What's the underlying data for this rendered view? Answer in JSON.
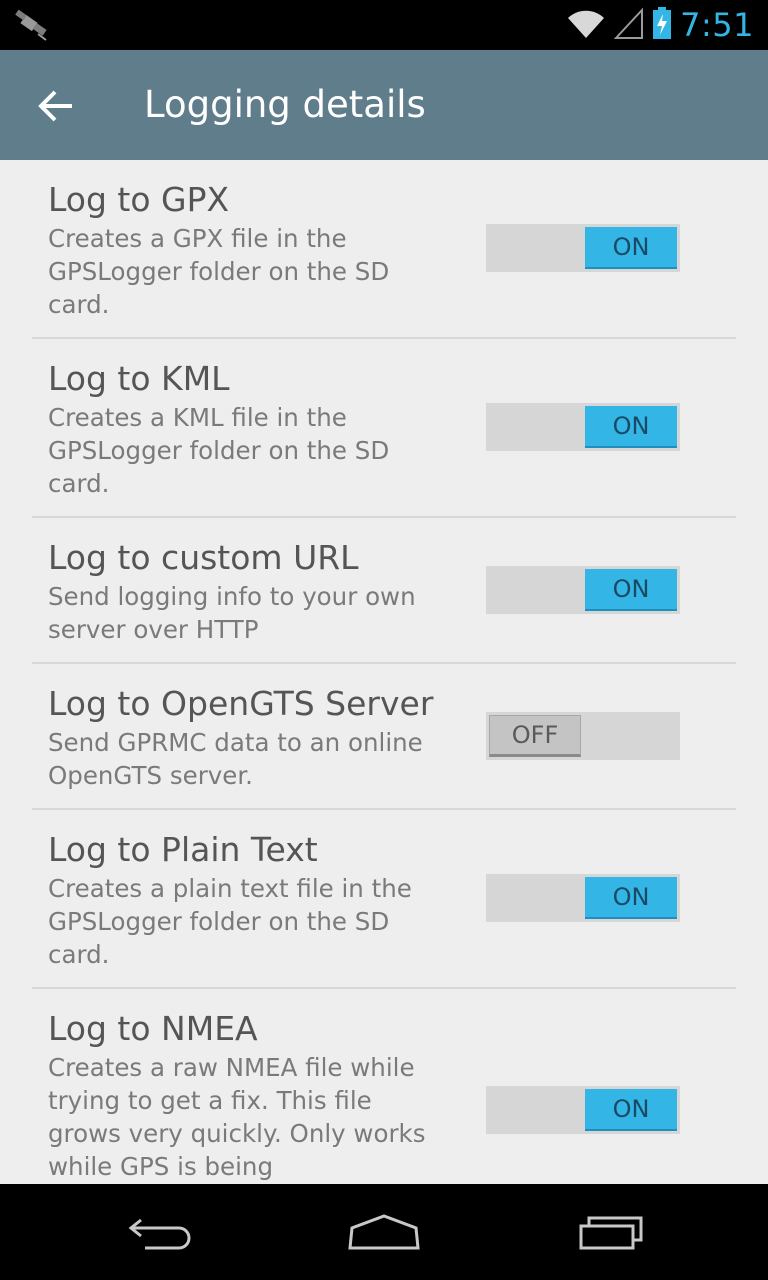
{
  "status_bar": {
    "time": "7:51",
    "icons": [
      "satellite-icon",
      "wifi-icon",
      "signal-icon",
      "battery-charging-icon"
    ],
    "clock_color": "#33b5e5"
  },
  "action_bar": {
    "title": "Logging details",
    "back_icon": "back-arrow-icon",
    "background": "#607d8b"
  },
  "items": [
    {
      "title": "Log to GPX",
      "summary": "Creates a GPX file in the GPSLogger folder on the SD card.",
      "state": "ON"
    },
    {
      "title": "Log to KML",
      "summary": "Creates a KML file in the GPSLogger folder on the SD card.",
      "state": "ON"
    },
    {
      "title": "Log to custom URL",
      "summary": "Send logging info to your own server over HTTP",
      "state": "ON"
    },
    {
      "title": "Log to OpenGTS Server",
      "summary": "Send GPRMC data to an online OpenGTS server.",
      "state": "OFF"
    },
    {
      "title": "Log to Plain Text",
      "summary": "Creates a plain text file in the GPSLogger folder on the SD card.",
      "state": "ON"
    },
    {
      "title": "Log to NMEA",
      "summary": "Creates a raw NMEA file while trying to get a fix. This file grows very quickly. Only works while GPS is being",
      "state": "ON"
    }
  ],
  "nav_bar": {
    "buttons": [
      "back-icon",
      "home-icon",
      "recent-apps-icon"
    ]
  },
  "colors": {
    "toggle_on": "#33b5e5",
    "toggle_off": "#c4c4c4",
    "list_background": "#eeeeee"
  }
}
